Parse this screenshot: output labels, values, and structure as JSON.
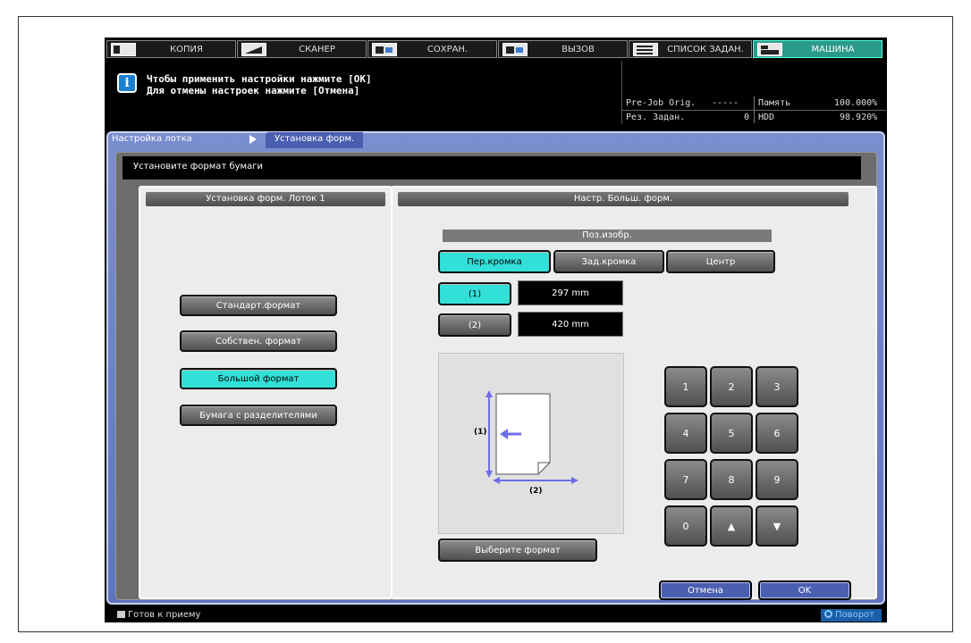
{
  "tabs": [
    {
      "label": "КОПИЯ",
      "icon": "copy-icon"
    },
    {
      "label": "СКАНЕР",
      "icon": "scanner-icon"
    },
    {
      "label": "СОХРАН.",
      "icon": "save-icon"
    },
    {
      "label": "ВЫЗОВ",
      "icon": "recall-icon"
    },
    {
      "label": "СПИСОК ЗАДАН.",
      "icon": "job-list-icon"
    },
    {
      "label": "МАШИНА",
      "icon": "machine-icon",
      "active": true
    }
  ],
  "message": {
    "line1": "Чтобы применить настройки нажмите [OK]",
    "line2": "Для отмены настроек нажмите [Отмена]"
  },
  "status": {
    "prejob_label": "Pre-Job Orig.",
    "prejob_value": "-----",
    "jobs_label": "Рез. Задан.",
    "jobs_value": "0",
    "memory_label": "Память",
    "memory_value": "100.000%",
    "hdd_label": "HDD",
    "hdd_value": "98.920%"
  },
  "breadcrumb": {
    "parent": "Настройка лотка",
    "current": "Установка форм."
  },
  "instruction": "Установите формат бумаги",
  "left_panel": {
    "title": "Установка форм.   Лоток 1",
    "buttons": [
      "Стандарт.формат",
      "Собствен. формат",
      "Большой формат",
      "Бумага с разделителями"
    ],
    "selected": "Большой формат"
  },
  "right_panel": {
    "title": "Настр. Больш. форм.",
    "image_pos_label": "Поз.изобр.",
    "pos_buttons": [
      "Пер.кромка",
      "Зад.кромка",
      "Центр"
    ],
    "pos_selected": "Пер.кромка",
    "dim1_label": "(1)",
    "dim1_value": "297  mm",
    "dim2_label": "(2)",
    "dim2_value": "420  mm",
    "diagram_label_1": "(1)",
    "diagram_label_2": "(2)",
    "select_format": "Выберите формат",
    "keypad": [
      "1",
      "2",
      "3",
      "4",
      "5",
      "6",
      "7",
      "8",
      "9",
      "0",
      "▲",
      "▼"
    ]
  },
  "actions": {
    "cancel": "Отмена",
    "ok": "OK"
  },
  "footer": {
    "ready": "Готов к приему",
    "rotate": "Поворот"
  },
  "colors": {
    "accent": "#33e0d8",
    "panel_blue": "#6b80c8",
    "active_tab": "#2a9a8a"
  }
}
